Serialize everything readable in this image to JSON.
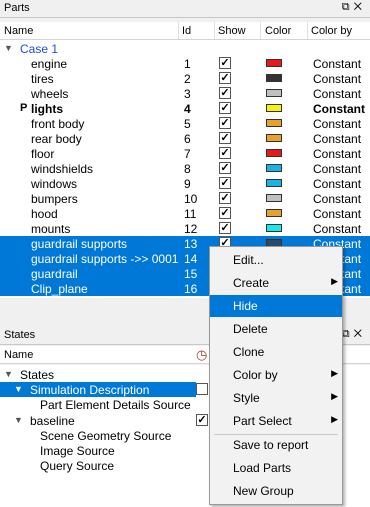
{
  "parts_panel": {
    "title": "Parts",
    "columns": {
      "name": "Name",
      "id": "Id",
      "show": "Show",
      "color": "Color",
      "color_by": "Color by"
    },
    "case_label": "Case 1",
    "rows": [
      {
        "name": "engine",
        "id": "1",
        "color": "#e8191a",
        "color_by": "Constant",
        "selected": false,
        "bold": false
      },
      {
        "name": "tires",
        "id": "2",
        "color": "#333333",
        "color_by": "Constant",
        "selected": false,
        "bold": false
      },
      {
        "name": "wheels",
        "id": "3",
        "color": "#c0c0c0",
        "color_by": "Constant",
        "selected": false,
        "bold": false
      },
      {
        "name": "lights",
        "id": "4",
        "color": "#f5f50a",
        "color_by": "Constant",
        "selected": false,
        "bold": true
      },
      {
        "name": "front body",
        "id": "5",
        "color": "#e8a030",
        "color_by": "Constant",
        "selected": false,
        "bold": false
      },
      {
        "name": "rear body",
        "id": "6",
        "color": "#e8a030",
        "color_by": "Constant",
        "selected": false,
        "bold": false
      },
      {
        "name": "floor",
        "id": "7",
        "color": "#e8191a",
        "color_by": "Constant",
        "selected": false,
        "bold": false
      },
      {
        "name": "windshields",
        "id": "8",
        "color": "#18b4e8",
        "color_by": "Constant",
        "selected": false,
        "bold": false
      },
      {
        "name": "windows",
        "id": "9",
        "color": "#18b4e8",
        "color_by": "Constant",
        "selected": false,
        "bold": false
      },
      {
        "name": "bumpers",
        "id": "10",
        "color": "#c0c0c0",
        "color_by": "Constant",
        "selected": false,
        "bold": false
      },
      {
        "name": "hood",
        "id": "11",
        "color": "#e8a030",
        "color_by": "Constant",
        "selected": false,
        "bold": false
      },
      {
        "name": "mounts",
        "id": "12",
        "color": "#18e8e8",
        "color_by": "Constant",
        "selected": false,
        "bold": false
      },
      {
        "name": "guardrail supports",
        "id": "13",
        "color": "#2a4a6a",
        "color_by": "Constant",
        "selected": true,
        "bold": false
      },
      {
        "name": "guardrail supports ->> 0001",
        "id": "14",
        "color": "",
        "color_by": "Constant",
        "selected": true,
        "bold": false
      },
      {
        "name": "guardrail",
        "id": "15",
        "color": "",
        "color_by": "Constant",
        "selected": true,
        "bold": false
      },
      {
        "name": "Clip_plane",
        "id": "16",
        "color": "",
        "color_by": "Constant",
        "selected": true,
        "bold": false
      }
    ]
  },
  "states_panel": {
    "title": "States",
    "column_name": "Name",
    "root": "States",
    "sim_desc": "Simulation Description",
    "part_elem": "Part Element Details Source",
    "baseline": "baseline",
    "scene_geom": "Scene Geometry Source",
    "image_source": "Image Source",
    "query_source": "Query Source"
  },
  "context_menu": {
    "items": [
      {
        "label": "Edit...",
        "submenu": false,
        "highlighted": false
      },
      {
        "label": "Create",
        "submenu": true,
        "highlighted": false
      },
      {
        "label": "Hide",
        "submenu": false,
        "highlighted": true
      },
      {
        "label": "Delete",
        "submenu": false,
        "highlighted": false
      },
      {
        "label": "Clone",
        "submenu": false,
        "highlighted": false
      },
      {
        "label": "Color by",
        "submenu": true,
        "highlighted": false
      },
      {
        "label": "Style",
        "submenu": true,
        "highlighted": false
      },
      {
        "label": "Part Select",
        "submenu": true,
        "highlighted": false
      },
      {
        "label": "Save to report",
        "submenu": false,
        "highlighted": false
      },
      {
        "label": "Load Parts",
        "submenu": false,
        "highlighted": false
      },
      {
        "label": "New Group",
        "submenu": false,
        "highlighted": false
      }
    ]
  },
  "icons": {
    "float": "float-icon",
    "close": "close-icon",
    "clock": "clock-icon"
  },
  "colors": {
    "accent": "#0078d7",
    "case_text": "#1a4ee8"
  }
}
